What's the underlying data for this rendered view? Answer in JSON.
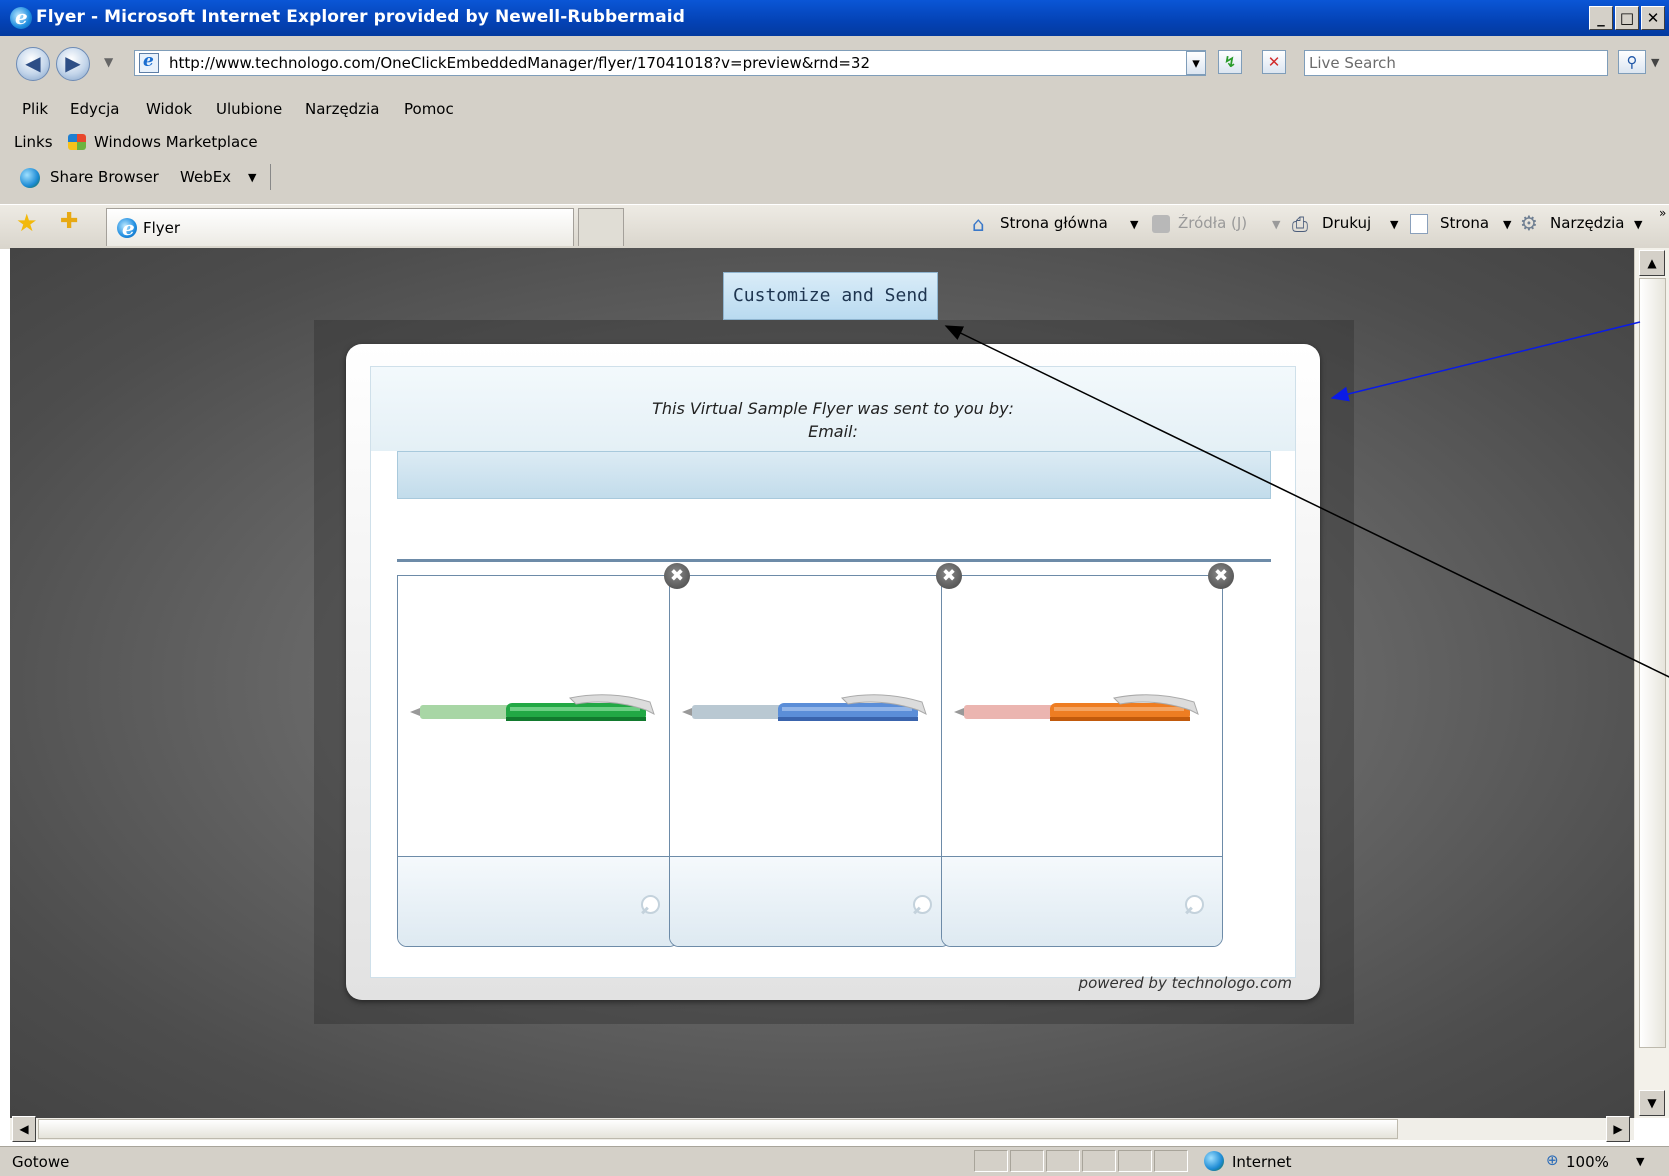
{
  "window": {
    "title": "Flyer - Microsoft Internet Explorer provided by Newell-Rubbermaid",
    "minimize": "_",
    "maximize": "□",
    "close": "✕"
  },
  "address_bar": {
    "url": "http://www.technologo.com/OneClickEmbeddedManager/flyer/17041018?v=preview&rnd=32",
    "go_glyph": "↯",
    "stop_glyph": "✕",
    "dropdown_glyph": "▾"
  },
  "search": {
    "placeholder": "Live Search"
  },
  "menu": [
    "Plik",
    "Edycja",
    "Widok",
    "Ulubione",
    "Narzędzia",
    "Pomoc"
  ],
  "links_bar": {
    "label": "Links",
    "item": "Windows Marketplace"
  },
  "toolbar": {
    "share": "Share Browser",
    "webex": "WebEx"
  },
  "tab": {
    "title": "Flyer"
  },
  "commands": {
    "home": "Strona główna",
    "feeds": "Źródła (J)",
    "print": "Drukuj",
    "page": "Strona",
    "tools": "Narzędzia"
  },
  "page": {
    "customize_button": "Customize and Send",
    "sent_by_line": "This Virtual Sample Flyer was sent to you by:",
    "email_line": "Email:",
    "powered_by": "powered by technologo.com",
    "products": [
      {
        "color_main": "#22a845",
        "color_grip": "#a8d6a5",
        "color_dark": "#127a2e"
      },
      {
        "color_main": "#5b8ed8",
        "color_grip": "#b9c8d2",
        "color_dark": "#3a64ad"
      },
      {
        "color_main": "#ee7d22",
        "color_grip": "#ebb5b0",
        "color_dark": "#c25a0c"
      }
    ],
    "close_glyph": "✖"
  },
  "status_bar": {
    "text": "Gotowe",
    "zone": "Internet",
    "zoom": "100%"
  },
  "colors": {
    "title_bar": "#0442b5",
    "chrome": "#d4d0c8",
    "background": "#6a6a6a",
    "button": "#c9e3f5"
  }
}
